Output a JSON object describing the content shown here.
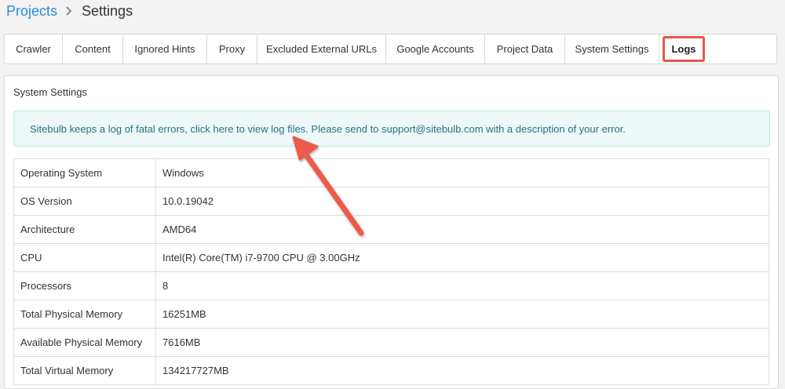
{
  "breadcrumb": {
    "parent": "Projects",
    "current": "Settings"
  },
  "tabs": [
    {
      "label": "Crawler",
      "width": 74
    },
    {
      "label": "Content",
      "width": 77
    },
    {
      "label": "Ignored Hints",
      "width": 107
    },
    {
      "label": "Proxy",
      "width": 64
    },
    {
      "label": "Excluded External URLs",
      "width": 164
    },
    {
      "label": "Google Accounts",
      "width": 126
    },
    {
      "label": "Project Data",
      "width": 102
    },
    {
      "label": "System Settings",
      "width": 120
    }
  ],
  "active_tab": {
    "label": "Logs"
  },
  "panel": {
    "title": "System Settings",
    "alert": {
      "prefix": "Sitebulb keeps a log of fatal errors, ",
      "link": "click here to view log files",
      "suffix": ". Please send to support@sitebulb.com with a description of your error."
    },
    "rows": [
      {
        "key": "Operating System",
        "value": "Windows"
      },
      {
        "key": "OS Version",
        "value": "10.0.19042"
      },
      {
        "key": "Architecture",
        "value": "AMD64"
      },
      {
        "key": "CPU",
        "value": "Intel(R) Core(TM) i7-9700 CPU @ 3.00GHz"
      },
      {
        "key": "Processors",
        "value": "8"
      },
      {
        "key": "Total Physical Memory",
        "value": "16251MB"
      },
      {
        "key": "Available Physical Memory",
        "value": "7616MB"
      },
      {
        "key": "Total Virtual Memory",
        "value": "134217727MB"
      }
    ]
  },
  "colors": {
    "link": "#2b8fd6",
    "alert_text": "#2a6f86",
    "alert_bg": "#eef8f9",
    "highlight": "#e8564a"
  },
  "icons": {
    "breadcrumb_separator": "chevron-right-icon",
    "annotation": "arrow-icon"
  }
}
